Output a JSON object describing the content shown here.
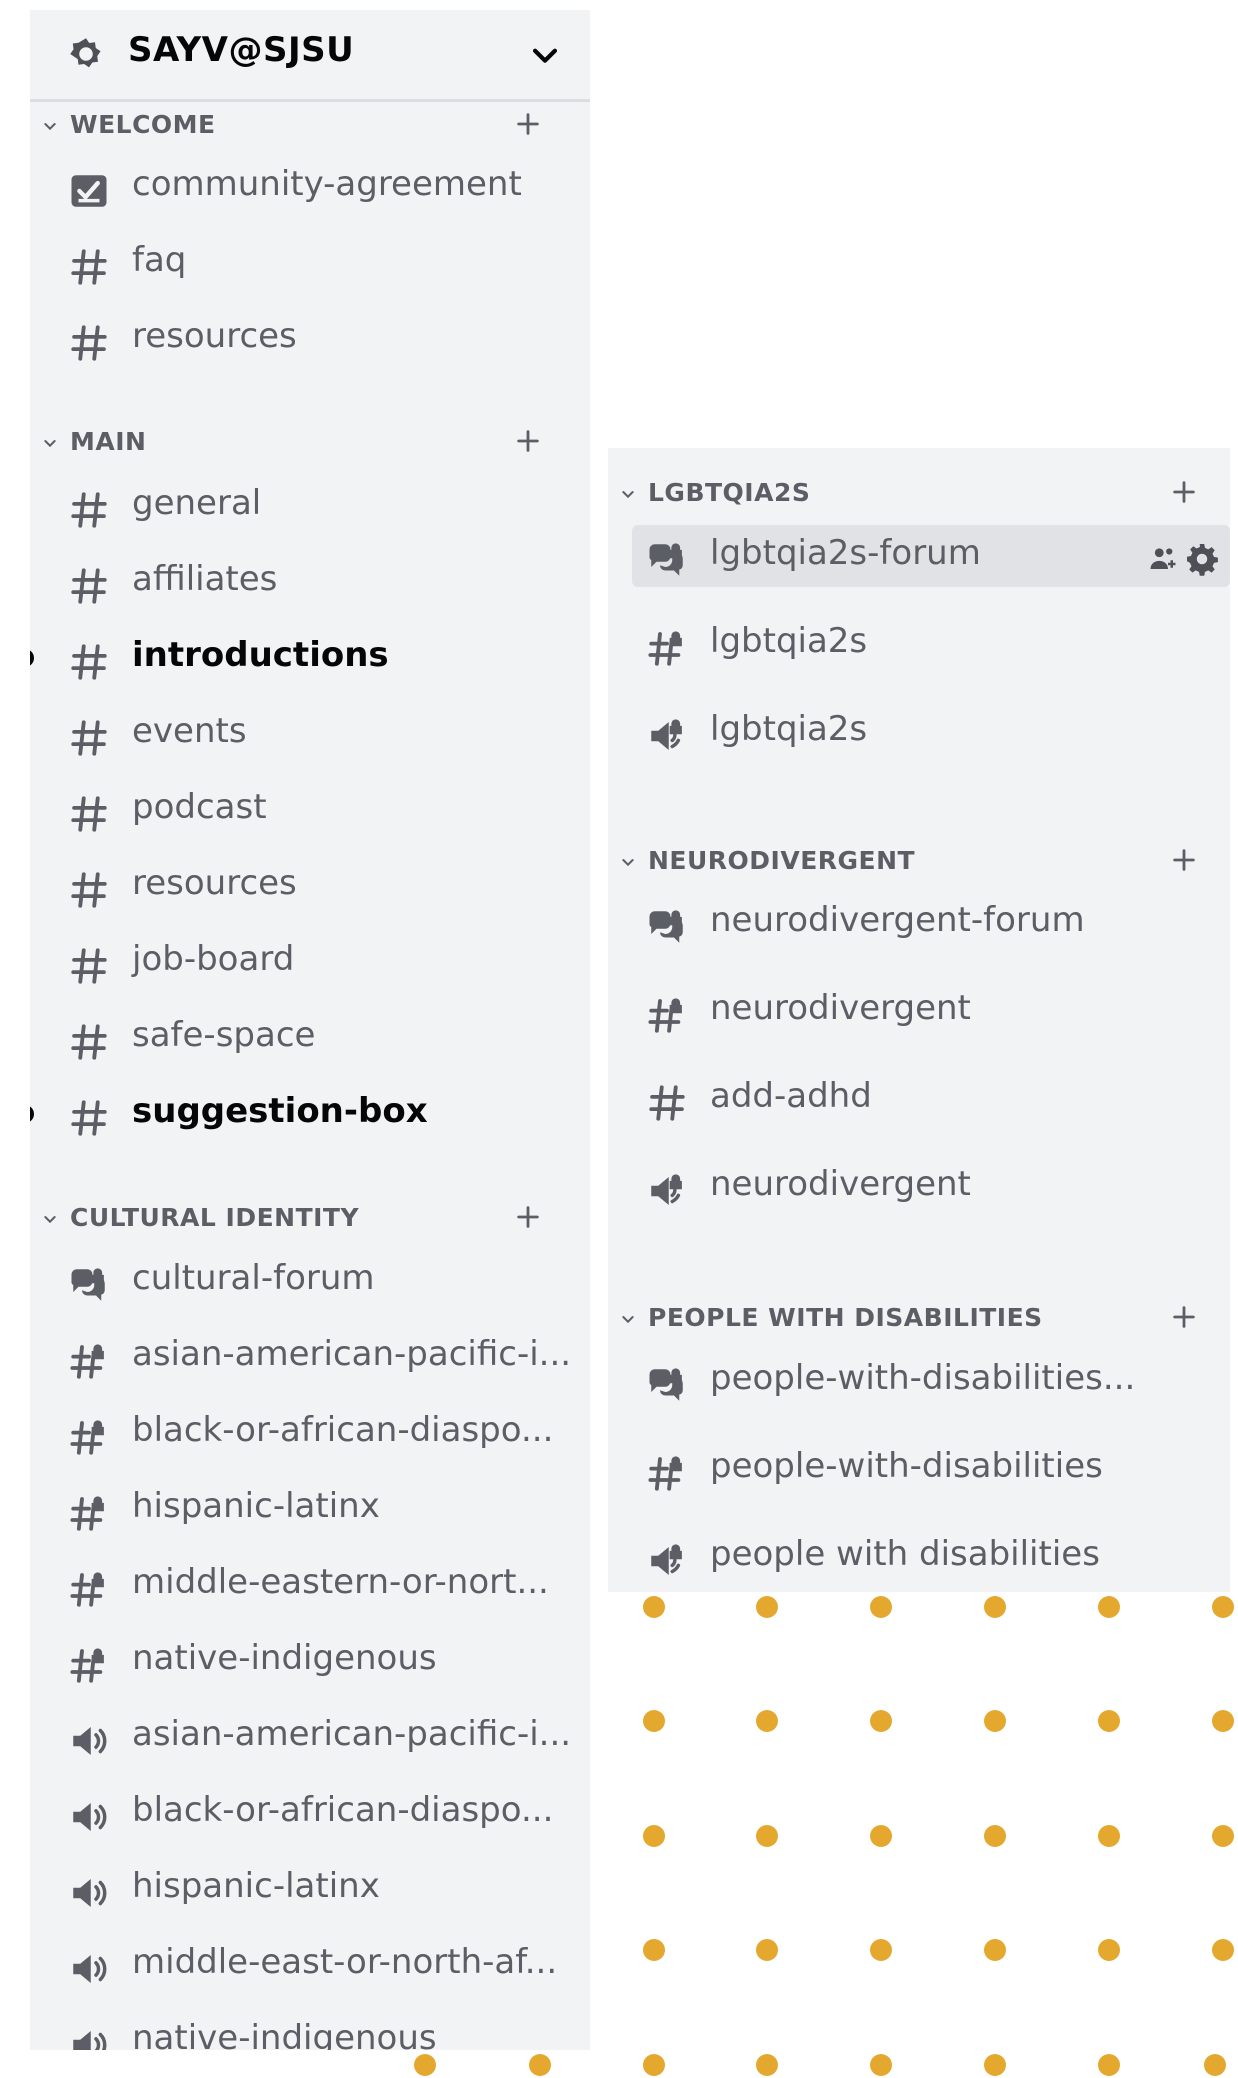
{
  "server": {
    "name": "SAYV@SJSU"
  },
  "left_panel": {
    "categories": [
      {
        "label": "WELCOME",
        "channels": [
          {
            "name": "community-agreement",
            "icon": "rules-icon"
          },
          {
            "name": "faq",
            "icon": "text-channel-icon"
          },
          {
            "name": "resources",
            "icon": "text-channel-icon"
          }
        ]
      },
      {
        "label": "MAIN",
        "channels": [
          {
            "name": "general",
            "icon": "text-channel-icon"
          },
          {
            "name": "affiliates",
            "icon": "text-channel-icon"
          },
          {
            "name": "introductions",
            "icon": "text-channel-icon",
            "unread": true
          },
          {
            "name": "events",
            "icon": "text-channel-icon"
          },
          {
            "name": "podcast",
            "icon": "text-channel-icon"
          },
          {
            "name": "resources",
            "icon": "text-channel-icon"
          },
          {
            "name": "job-board",
            "icon": "text-channel-icon"
          },
          {
            "name": "safe-space",
            "icon": "text-channel-icon"
          },
          {
            "name": "suggestion-box",
            "icon": "text-channel-icon",
            "unread": true
          }
        ]
      },
      {
        "label": "CULTURAL IDENTITY",
        "channels": [
          {
            "name": "cultural-forum",
            "icon": "private-forum-icon"
          },
          {
            "name": "asian-american-pacific-i...",
            "icon": "private-text-channel-icon"
          },
          {
            "name": "black-or-african-diaspo...",
            "icon": "private-text-channel-icon"
          },
          {
            "name": "hispanic-latinx",
            "icon": "private-text-channel-icon"
          },
          {
            "name": "middle-eastern-or-nort...",
            "icon": "private-text-channel-icon"
          },
          {
            "name": "native-indigenous",
            "icon": "private-text-channel-icon"
          },
          {
            "name": "asian-american-pacific-i...",
            "icon": "voice-channel-icon"
          },
          {
            "name": "black-or-african-diaspo...",
            "icon": "voice-channel-icon"
          },
          {
            "name": "hispanic-latinx",
            "icon": "voice-channel-icon"
          },
          {
            "name": "middle-east-or-north-af...",
            "icon": "voice-channel-icon"
          },
          {
            "name": "native-indigenous",
            "icon": "voice-channel-icon"
          }
        ]
      }
    ]
  },
  "right_panel": {
    "categories": [
      {
        "label": "LGBTQIA2S",
        "channels": [
          {
            "name": "lgbtqia2s-forum",
            "icon": "private-forum-icon",
            "selected": true
          },
          {
            "name": "lgbtqia2s",
            "icon": "private-text-channel-icon"
          },
          {
            "name": "lgbtqia2s",
            "icon": "private-voice-channel-icon"
          }
        ]
      },
      {
        "label": "NEURODIVERGENT",
        "channels": [
          {
            "name": "neurodivergent-forum",
            "icon": "private-forum-icon"
          },
          {
            "name": "neurodivergent",
            "icon": "private-text-channel-icon"
          },
          {
            "name": "add-adhd",
            "icon": "text-channel-icon"
          },
          {
            "name": "neurodivergent",
            "icon": "private-voice-channel-icon"
          }
        ]
      },
      {
        "label": "PEOPLE WITH DISABILITIES",
        "channels": [
          {
            "name": "people-with-disabilities...",
            "icon": "private-forum-icon"
          },
          {
            "name": "people-with-disabilities",
            "icon": "private-text-channel-icon"
          },
          {
            "name": "people with disabilities",
            "icon": "private-voice-channel-icon"
          }
        ]
      }
    ]
  },
  "colors": {
    "sidebar_bg": "#f2f3f5",
    "selected_bg": "#e1e2e5",
    "channel_text": "#5c5e66",
    "unread_text": "#060607",
    "accent_dots": "#e5a82f"
  }
}
